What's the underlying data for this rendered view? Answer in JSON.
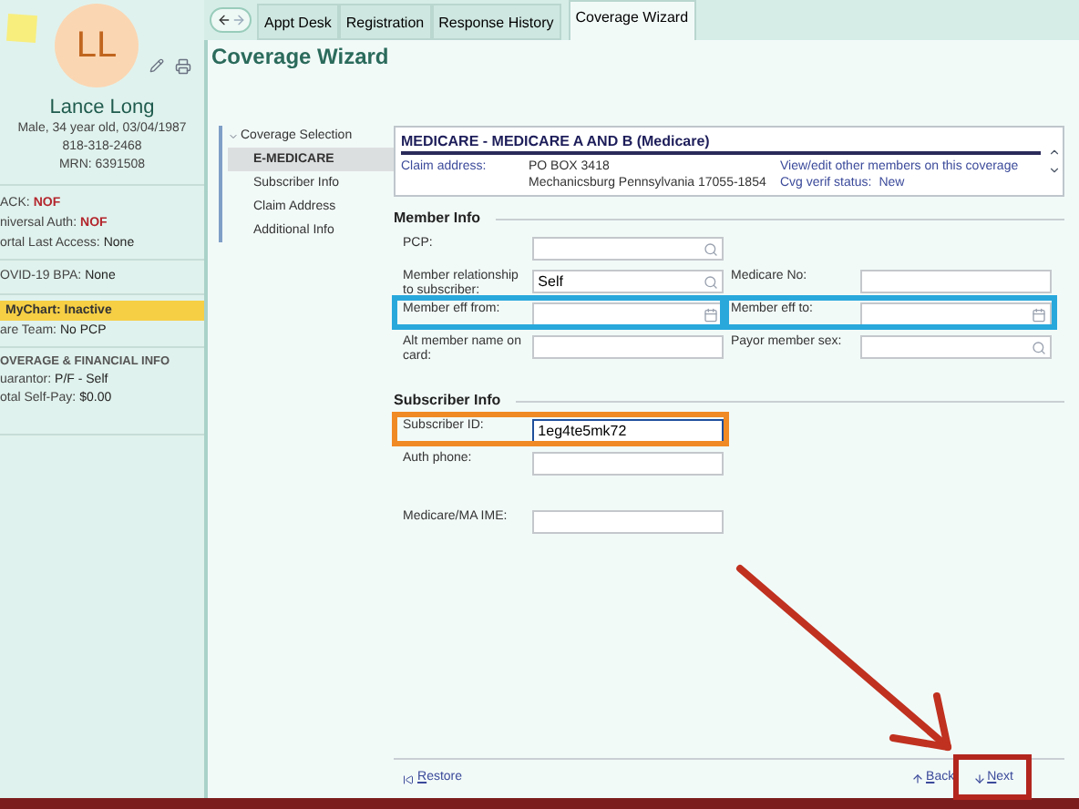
{
  "patient": {
    "initials": "LL",
    "name": "Lance Long",
    "details": [
      "Male, 34 year old, 03/04/1987",
      "818-318-2468",
      "MRN: 6391508"
    ]
  },
  "flags": [
    {
      "label": "ACK:",
      "value": "NOF",
      "kind": "alert"
    },
    {
      "label": "niversal Auth:",
      "value": "NOF",
      "kind": "alert"
    },
    {
      "label": "ortal Last Access:",
      "value": "None",
      "kind": "plain"
    }
  ],
  "covid": {
    "label": "OVID-19 BPA:",
    "value": "None"
  },
  "mychart": {
    "text": "MyChart: Inactive"
  },
  "care_team": {
    "label": "are Team:",
    "value": "No PCP"
  },
  "coverage_info": {
    "heading": "OVERAGE & FINANCIAL INFO",
    "items": [
      {
        "label": "uarantor:",
        "value": "P/F - Self"
      },
      {
        "label": "otal Self-Pay:",
        "value": "$0.00"
      }
    ]
  },
  "tabs": [
    {
      "label": "Appt Desk",
      "selected": false
    },
    {
      "label": "Registration",
      "selected": false
    },
    {
      "label": "Response History",
      "selected": false
    },
    {
      "label": "Coverage Wizard",
      "selected": true
    }
  ],
  "page_title": "Coverage Wizard",
  "wizard_nav": {
    "group": "Coverage Selection",
    "expanded": true,
    "items": [
      {
        "label": "E-MEDICARE",
        "selected": true
      },
      {
        "label": "Subscriber Info",
        "selected": false
      },
      {
        "label": "Claim Address",
        "selected": false
      },
      {
        "label": "Additional Info",
        "selected": false
      }
    ]
  },
  "coverage": {
    "title": "MEDICARE - MEDICARE A AND B (Medicare)",
    "claim_label": "Claim address:",
    "address": [
      "PO BOX 3418",
      "Mechanicsburg Pennsylvania 17055-1854"
    ],
    "link": "View/edit other members on this coverage",
    "verif_label": "Cvg verif status:",
    "verif_value": "New"
  },
  "sections": [
    {
      "title": "Member Info",
      "rows": [
        [
          {
            "label": "PCP:",
            "kind": "lookup"
          }
        ],
        [
          {
            "label": "Member relationship to subscriber:",
            "kind": "lookup",
            "value": "Self"
          },
          {
            "label": "Medicare No:",
            "kind": "text"
          }
        ],
        [
          {
            "label": "Member eff from:",
            "kind": "date"
          },
          {
            "label": "Member eff to:",
            "kind": "date"
          }
        ],
        [
          {
            "label": "Alt member name on card:",
            "kind": "text"
          },
          {
            "label": "Payor member sex:",
            "kind": "lookup"
          }
        ]
      ]
    },
    {
      "title": "Subscriber Info",
      "rows": [
        [
          {
            "label": "Subscriber ID:",
            "kind": "text",
            "value": "1eg4te5mk72",
            "focused": true
          }
        ],
        [
          {
            "label": "Auth phone:",
            "kind": "text"
          }
        ],
        [
          {
            "label": "Medicare/MA IME:",
            "kind": "text"
          }
        ]
      ]
    }
  ],
  "footer": {
    "restore": "Restore",
    "back": "Back",
    "next": "Next"
  }
}
